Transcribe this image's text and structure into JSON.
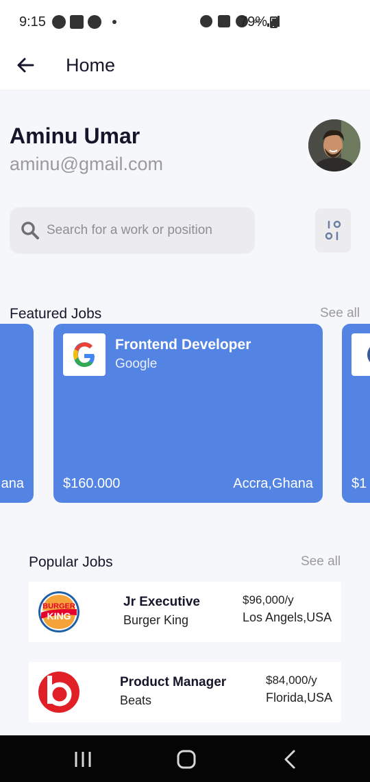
{
  "status_bar": {
    "time": "9:15",
    "battery": "79%",
    "network": "4G"
  },
  "app_bar": {
    "title": "Home"
  },
  "user": {
    "name": "Aminu Umar",
    "email": "aminu@gmail.com"
  },
  "search": {
    "placeholder": "Search for a work or position"
  },
  "featured": {
    "title": "Featured Jobs",
    "see_all": "See all",
    "left_partial": {
      "location_fragment": "ana"
    },
    "main": {
      "title": "Frontend Developer",
      "company": "Google",
      "salary": "$160.000",
      "location": "Accra,Ghana"
    },
    "right_partial": {
      "salary_fragment": "$1"
    }
  },
  "popular": {
    "title": "Popular Jobs",
    "see_all": "See all",
    "items": [
      {
        "title": "Jr Executive",
        "company": "Burger King",
        "salary": "$96,000/y",
        "location": "Los Angels,USA",
        "logo": "burger-king-logo"
      },
      {
        "title": "Product Manager",
        "company": "Beats",
        "salary": "$84,000/y",
        "location": "Florida,USA",
        "logo": "beats-logo"
      }
    ]
  },
  "colors": {
    "card_blue": "#5384e3",
    "background": "#f6f7fa",
    "nav_bar": "#050505"
  }
}
